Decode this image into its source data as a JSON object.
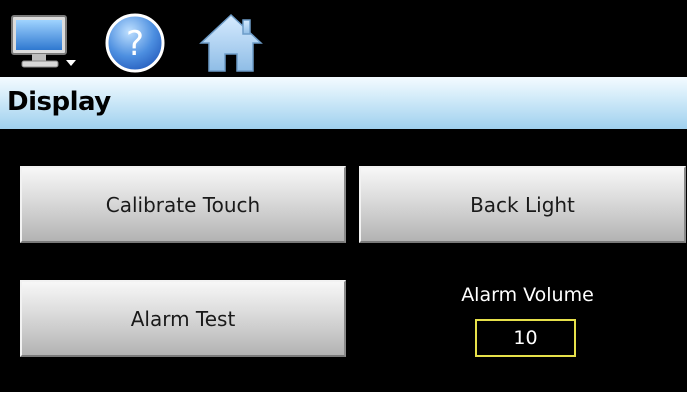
{
  "header": {
    "icons": [
      {
        "name": "monitor-icon",
        "color": "#5aa0e6"
      },
      {
        "name": "help-icon",
        "glyph": "?",
        "color": "#2f6fd6"
      },
      {
        "name": "home-icon",
        "color": "#a9cdea"
      }
    ]
  },
  "title_bar": {
    "title": "Display"
  },
  "buttons": {
    "calibrate_touch": "Calibrate Touch",
    "back_light": "Back Light",
    "alarm_test": "Alarm Test"
  },
  "alarm_volume": {
    "label": "Alarm Volume",
    "value": "10",
    "field_border_color": "#e6e04a"
  },
  "colors": {
    "background": "#000000",
    "title_bar_gradient": [
      "#f4fbff",
      "#9fd0ee"
    ],
    "button_gradient": [
      "#f7f7f7",
      "#b3b3b3"
    ]
  }
}
